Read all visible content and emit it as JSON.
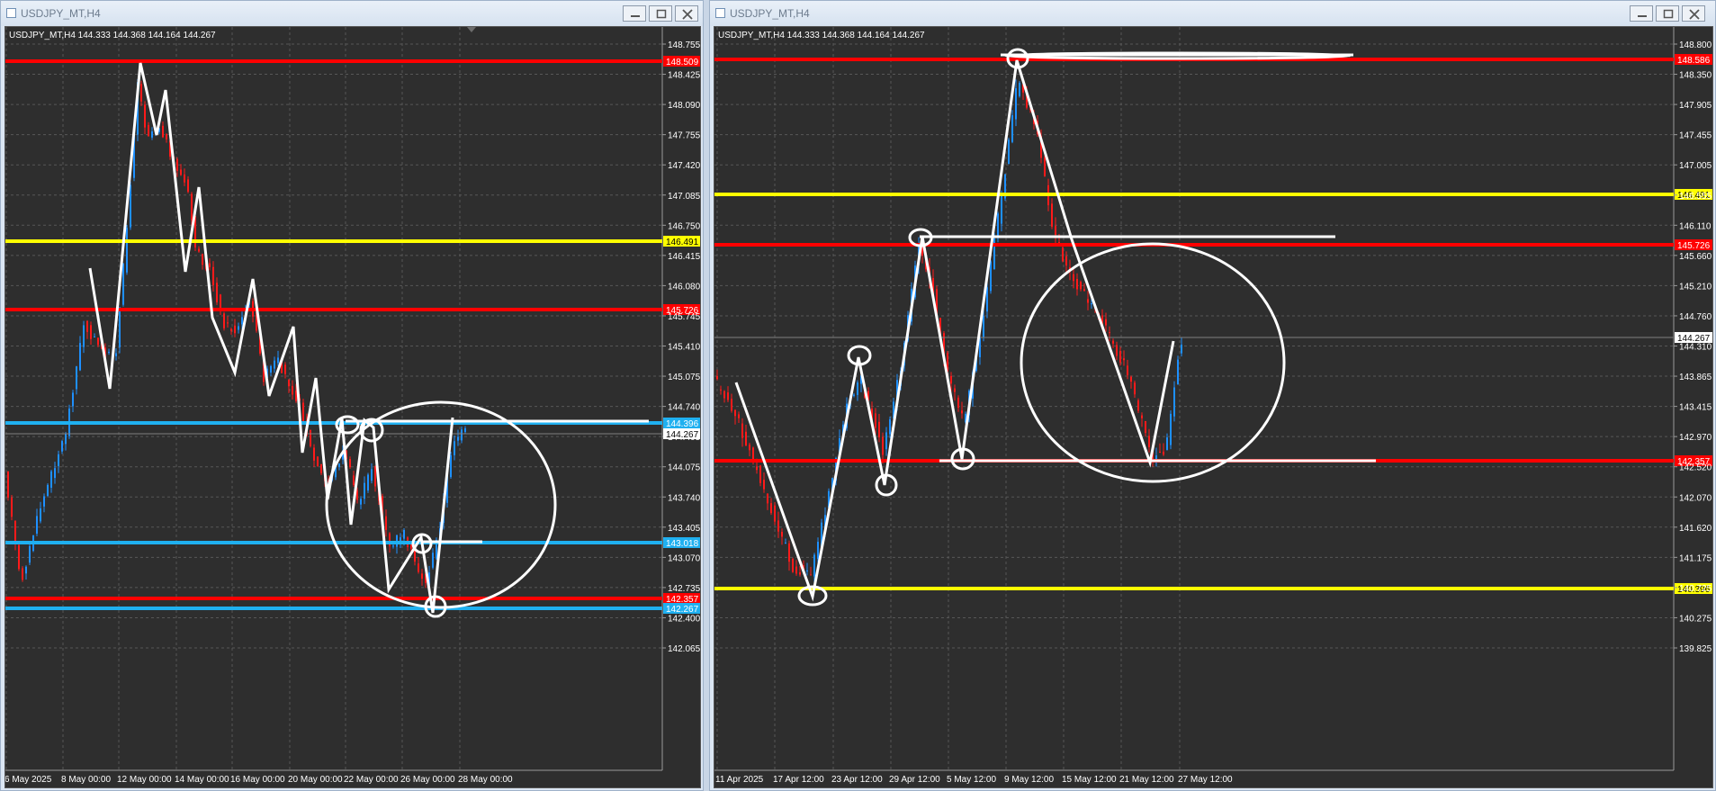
{
  "left": {
    "window_title": "USDJPY_MT,H4",
    "info_label": "USDJPY_MT,H4  144.333 144.368 144.164 144.267",
    "price_ticks": [
      "148.755",
      "148.425",
      "148.090",
      "147.755",
      "147.420",
      "147.085",
      "146.750",
      "146.415",
      "146.080",
      "145.745",
      "145.410",
      "145.075",
      "144.740",
      "144.405",
      "144.075",
      "143.740",
      "143.405",
      "143.070",
      "142.735",
      "142.400",
      "142.065"
    ],
    "time_ticks": [
      "6 May 2025",
      "8 May 00:00",
      "12 May 00:00",
      "14 May 00:00",
      "16 May 00:00",
      "20 May 00:00",
      "22 May 00:00",
      "26 May 00:00",
      "28 May 00:00"
    ],
    "levels": [
      {
        "label": "148.509",
        "color": "#ff0000"
      },
      {
        "label": "146.491",
        "color": "#ffff00"
      },
      {
        "label": "145.726",
        "color": "#ff0000"
      },
      {
        "label": "144.396",
        "color": "#1fb0f0"
      },
      {
        "label": "143.018",
        "color": "#1fb0f0"
      },
      {
        "label": "142.357",
        "color": "#ff0000"
      },
      {
        "label": "142.267",
        "color": "#1fb0f0"
      }
    ],
    "current_price": "144.267"
  },
  "right": {
    "window_title": "USDJPY_MT,H4",
    "info_label": "USDJPY_MT,H4  144.333 144.368 144.164 144.267",
    "price_ticks": [
      "148.800",
      "148.350",
      "147.905",
      "147.455",
      "147.005",
      "146.555",
      "146.110",
      "145.660",
      "145.210",
      "144.760",
      "144.310",
      "143.865",
      "143.415",
      "142.970",
      "142.520",
      "142.070",
      "141.620",
      "141.175",
      "140.725",
      "140.275",
      "139.825"
    ],
    "time_ticks": [
      "11 Apr 2025",
      "17 Apr 12:00",
      "23 Apr 12:00",
      "29 Apr 12:00",
      "5 May 12:00",
      "9 May 12:00",
      "15 May 12:00",
      "21 May 12:00",
      "27 May 12:00"
    ],
    "levels": [
      {
        "label": "148.586",
        "color": "#ff0000"
      },
      {
        "label": "146.491",
        "color": "#ffff00"
      },
      {
        "label": "145.726",
        "color": "#ff0000"
      },
      {
        "label": "142.357",
        "color": "#ff0000"
      },
      {
        "label": "140.396",
        "color": "#ffff00"
      }
    ],
    "current_price": "144.267"
  }
}
